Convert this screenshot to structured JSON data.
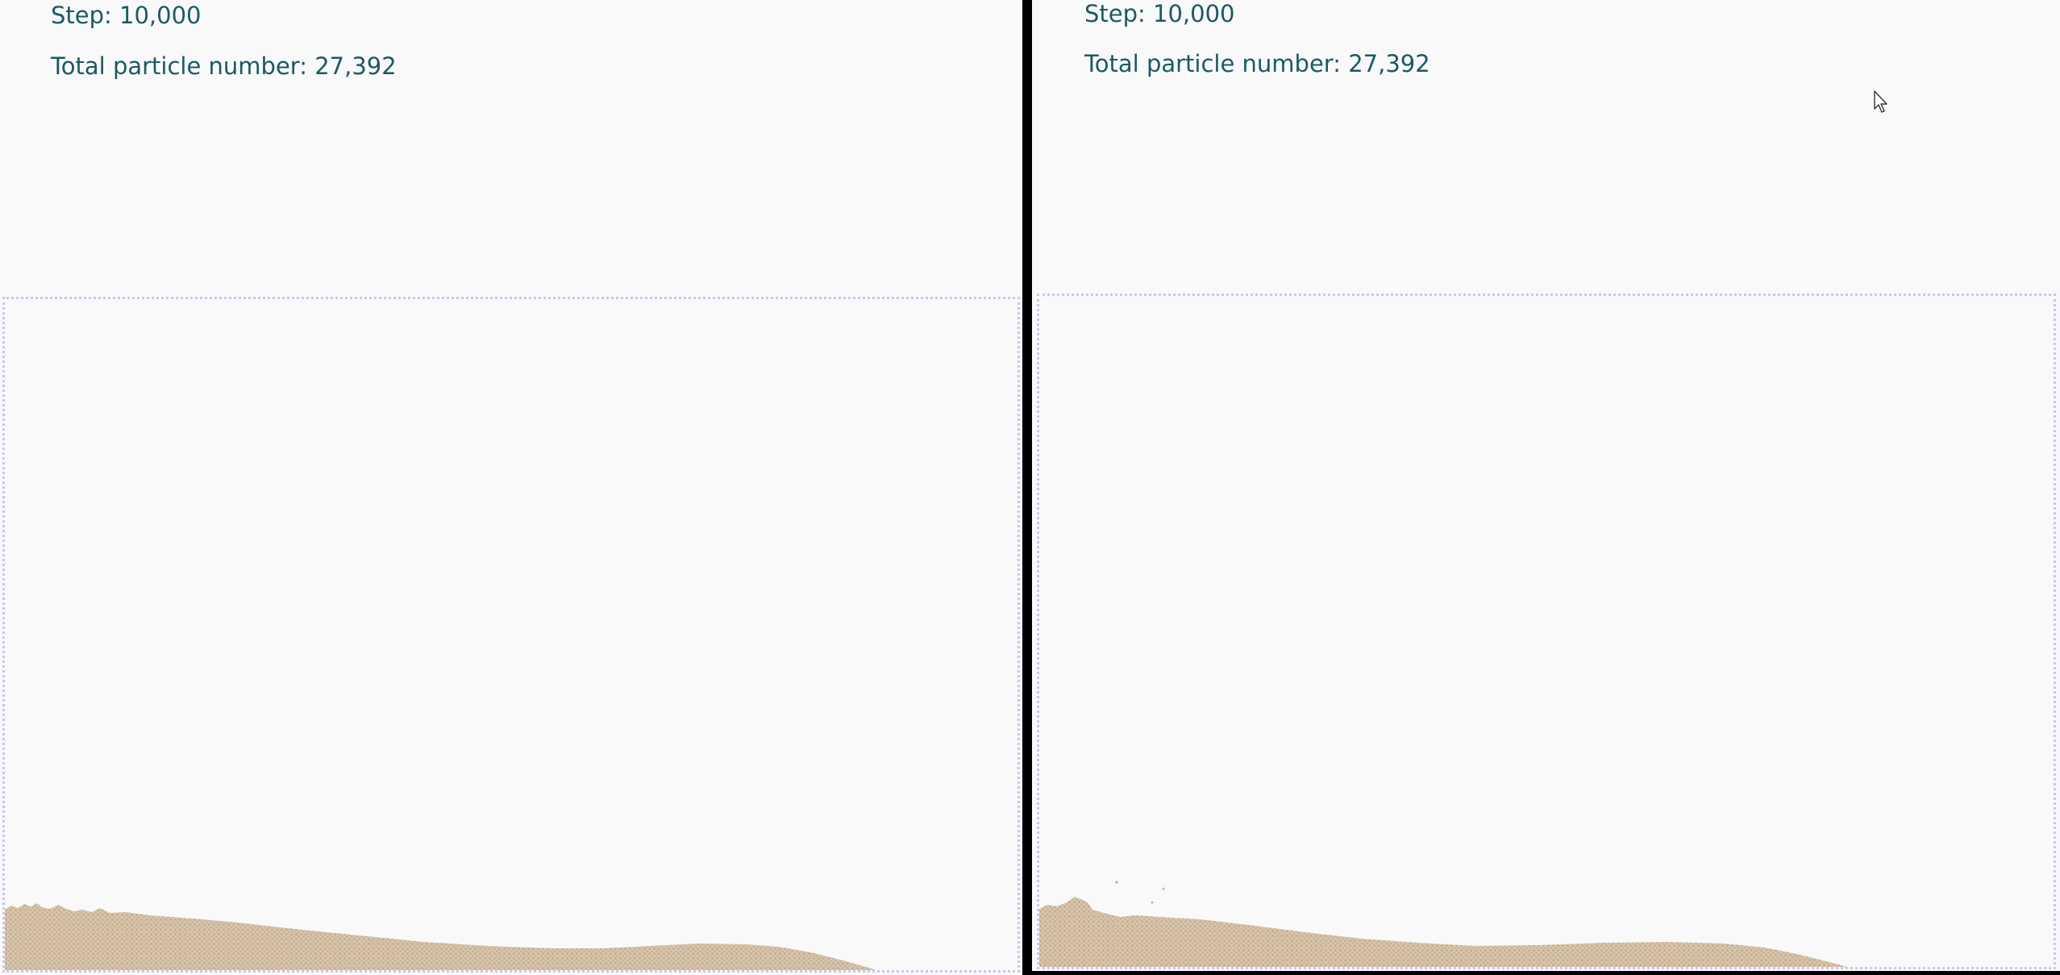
{
  "left_view": {
    "step_text": "Step: 10,000",
    "particle_text": "Total particle number: 27,392"
  },
  "right_view": {
    "step_text": "Step: 10,000",
    "particle_text": "Total particle number: 27,392"
  },
  "colors": {
    "text": "#1b5a63",
    "background": "#f9f9fa",
    "container_border": "#c6c8f2",
    "sand": "#d2bea2",
    "divider": "#000000"
  },
  "icons": {
    "cursor": "mouse-pointer-icon"
  }
}
